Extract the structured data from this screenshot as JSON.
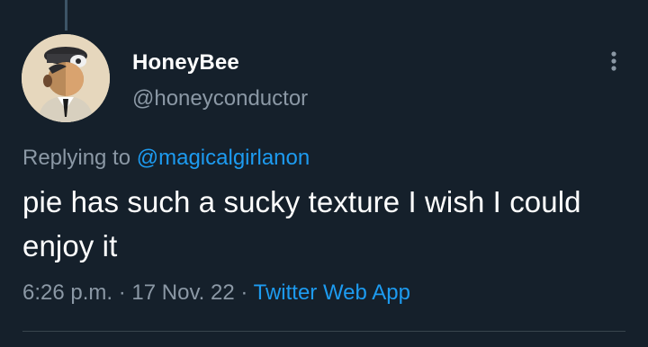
{
  "tweet": {
    "author": {
      "display_name": "HoneyBee",
      "handle": "@honeyconductor",
      "avatar_icon": "avatar-conductor-character"
    },
    "replying_prefix": "Replying to",
    "replying_to": "@magicalgirlanon",
    "text": "pie has such a sucky texture I wish I could enjoy it",
    "time": "6:26 p.m.",
    "separator_1": "·",
    "date": "17 Nov. 22",
    "separator_2": "·",
    "source": "Twitter Web App",
    "more_icon": "more-vertical-icon"
  },
  "colors": {
    "background": "#15202b",
    "primary_text": "#ffffff",
    "secondary_text": "#8b98a5",
    "link": "#1d9bf0",
    "divider": "#38444d"
  }
}
